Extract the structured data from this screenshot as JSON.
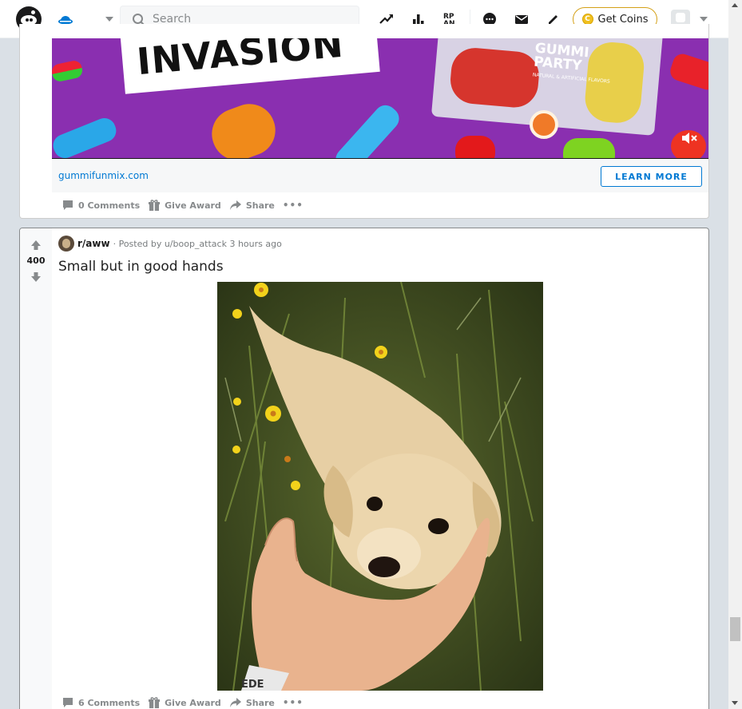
{
  "header": {
    "search_placeholder": "Search",
    "get_coins_label": "Get Coins",
    "coin_symbol": "C",
    "icons": [
      "reddit-logo",
      "home-icon",
      "trending-icon",
      "stats-icon",
      "rpan-icon",
      "chat-icon",
      "mail-icon",
      "create-post-icon",
      "avatar"
    ]
  },
  "ad": {
    "banner_headline": "INVASION",
    "product_brand": "GUMMI\nPARTY",
    "product_sub": "NATURAL & ARTIFICIAL FLAVORS",
    "domain": "gummifunmix.com",
    "cta_label": "LEARN MORE",
    "comments_label": "0 Comments",
    "award_label": "Give Award",
    "share_label": "Share",
    "more_label": "•••"
  },
  "post": {
    "score": "400",
    "subreddit": "r/aww",
    "posted_by": "· Posted by u/boop_attack 3 hours ago",
    "title": "Small but in good hands",
    "comments_label": "6 Comments",
    "award_label": "Give Award",
    "share_label": "Share",
    "more_label": "•••"
  },
  "colors": {
    "accent": "#0079d3",
    "banner": "#8a2fb0",
    "page_bg": "#dae0e6",
    "coin_gold": "#f0c020"
  }
}
